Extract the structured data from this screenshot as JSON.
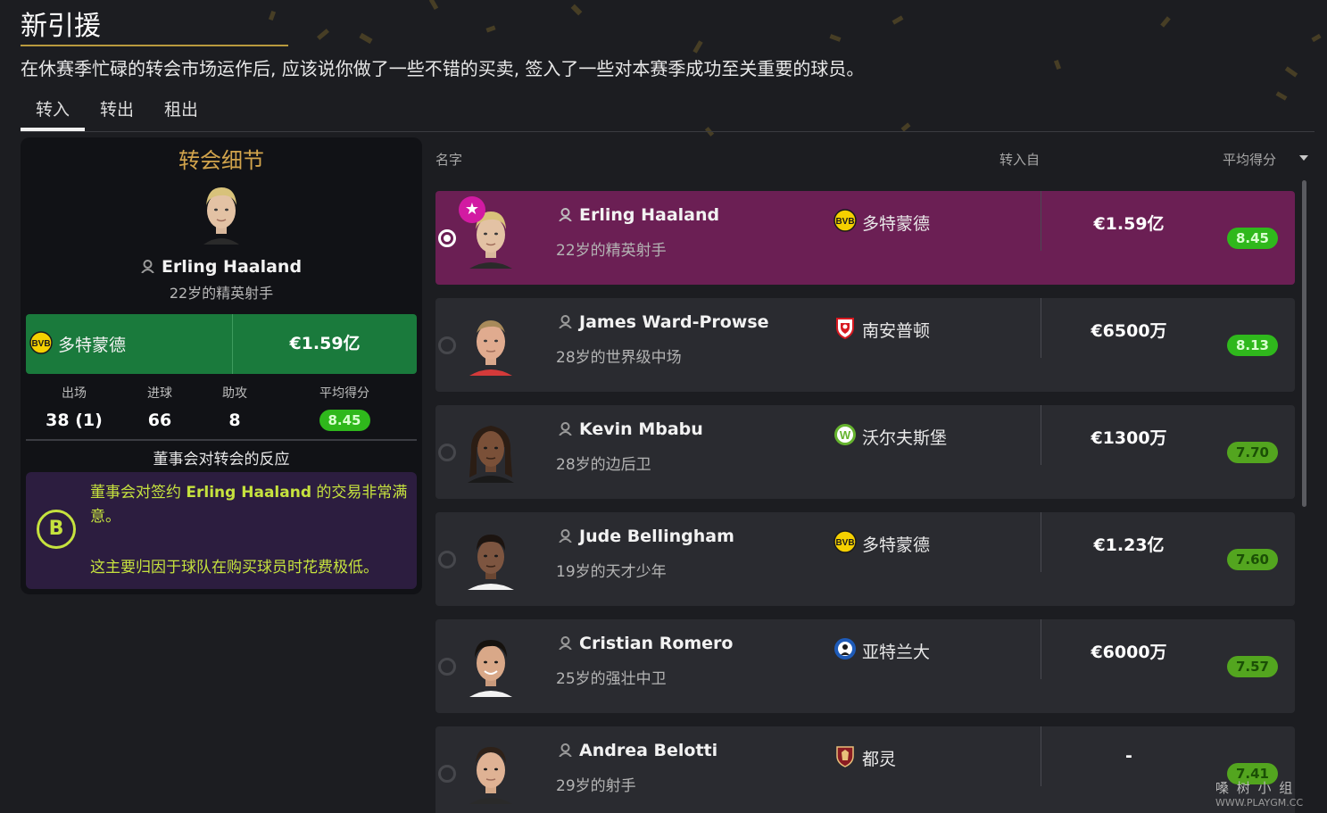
{
  "header": {
    "title": "新引援",
    "subtitle": "在休赛季忙碌的转会市场运作后, 应该说你做了一些不错的买卖, 签入了一些对本赛季成功至关重要的球员。"
  },
  "tabs": [
    {
      "label": "转入",
      "active": true
    },
    {
      "label": "转出",
      "active": false
    },
    {
      "label": "租出",
      "active": false
    }
  ],
  "details": {
    "title": "转会细节",
    "player_name": "Erling Haaland",
    "player_desc": "22岁的精英射手",
    "club": "多特蒙德",
    "fee": "€1.59亿",
    "stats": [
      {
        "label": "出场",
        "value": "38 (1)"
      },
      {
        "label": "进球",
        "value": "66"
      },
      {
        "label": "助攻",
        "value": "8"
      },
      {
        "label": "平均得分",
        "value": "8.45"
      }
    ],
    "reaction_title": "董事会对转会的反应",
    "reaction_grade": "B",
    "reaction_line1_a": "董事会对签约",
    "reaction_line1_b": "Erling Haaland",
    "reaction_line1_c": "的交易非常满意。",
    "reaction_line2": "这主要归因于球队在购买球员时花费极低。"
  },
  "table": {
    "col_name": "名字",
    "col_from": "转入自",
    "col_rating": "平均得分",
    "sort_icon": "chevron-down-icon",
    "rows": [
      {
        "name": "Erling Haaland",
        "desc": "22岁的精英射手",
        "club": "多特蒙德",
        "club_crest": "dortmund",
        "fee": "€1.59亿",
        "rating": "8.45",
        "selected": true
      },
      {
        "name": "James Ward-Prowse",
        "desc": "28岁的世界级中场",
        "club": "南安普顿",
        "club_crest": "southampton",
        "fee": "€6500万",
        "rating": "8.13",
        "selected": false
      },
      {
        "name": "Kevin Mbabu",
        "desc": "28岁的边后卫",
        "club": "沃尔夫斯堡",
        "club_crest": "wolfsburg",
        "fee": "€1300万",
        "rating": "7.70",
        "selected": false
      },
      {
        "name": "Jude Bellingham",
        "desc": "19岁的天才少年",
        "club": "多特蒙德",
        "club_crest": "dortmund",
        "fee": "€1.23亿",
        "rating": "7.60",
        "selected": false
      },
      {
        "name": "Cristian Romero",
        "desc": "25岁的强壮中卫",
        "club": "亚特兰大",
        "club_crest": "atalanta",
        "fee": "€6000万",
        "rating": "7.57",
        "selected": false
      },
      {
        "name": "Andrea Belotti",
        "desc": "29岁的射手",
        "club": "都灵",
        "club_crest": "torino",
        "fee": "-",
        "rating": "7.41",
        "selected": false
      }
    ]
  },
  "watermark": {
    "line1": "嗓 树 小 组",
    "line2": "WWW.PLAYGM.CC"
  },
  "colors": {
    "accent_gold": "#d2a44c",
    "selected_row": "#6b1f54",
    "fee_green": "#1a7a3c",
    "reaction_bg": "#2c1d3f",
    "reaction_text": "#c6e23e",
    "rating_green": "#53a51f",
    "rating_green_hi": "#2fb81c"
  }
}
